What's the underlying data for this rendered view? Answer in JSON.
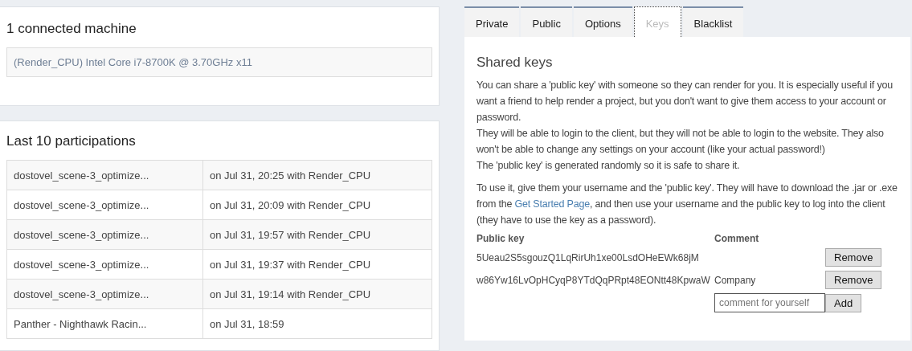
{
  "machines": {
    "title": "1 connected machine",
    "items": [
      "(Render_CPU) Intel Core i7-8700K @ 3.70GHz x11"
    ]
  },
  "participations": {
    "title": "Last 10 participations",
    "rows": [
      {
        "project": "dostovel_scene-3_optimize...",
        "detail": "on Jul 31, 20:25 with Render_CPU"
      },
      {
        "project": "dostovel_scene-3_optimize...",
        "detail": "on Jul 31, 20:09 with Render_CPU"
      },
      {
        "project": "dostovel_scene-3_optimize...",
        "detail": "on Jul 31, 19:57 with Render_CPU"
      },
      {
        "project": "dostovel_scene-3_optimize...",
        "detail": "on Jul 31, 19:37 with Render_CPU"
      },
      {
        "project": "dostovel_scene-3_optimize...",
        "detail": "on Jul 31, 19:14 with Render_CPU"
      },
      {
        "project": "Panther - Nighthawk Racin...",
        "detail": "on Jul 31, 18:59"
      }
    ]
  },
  "tabs": [
    {
      "label": "Private",
      "selected": false
    },
    {
      "label": "Public",
      "selected": false
    },
    {
      "label": "Options",
      "selected": false
    },
    {
      "label": "Keys",
      "selected": true
    },
    {
      "label": "Blacklist",
      "selected": false
    }
  ],
  "keys": {
    "title": "Shared keys",
    "intro_lines": [
      "You can share a 'public key' with someone so they can render for you. It is especially useful if you want a friend to help render a project, but you don't want to give them access to your account or password.",
      "They will be able to login to the client, but they will not be able to login to the website. They also won't be able to change any settings on your account (like your actual password!)",
      "The 'public key' is generated randomly so it is safe to share it."
    ],
    "usage": {
      "before": "To use it, give them your username and the 'public key'. They will have to download the .jar or .exe from the",
      "link": "Get Started Page",
      "after": ", and then use your username and the public key to log into the client (they have to use the key as a password)."
    },
    "columns": [
      "Public key",
      "Comment"
    ],
    "rows": [
      {
        "key": "5Ueau2S5sgouzQ1LqRirUh1xe00LsdOHeEWk68jM",
        "comment": "",
        "button": "Remove"
      },
      {
        "key": "w86Yw16LvOpHCyqP8YTdQqPRpt48EONtt48KpwaW",
        "comment": "Company",
        "button": "Remove"
      }
    ],
    "new_comment": {
      "placeholder": "comment for yourself"
    },
    "add_button": "Add"
  }
}
